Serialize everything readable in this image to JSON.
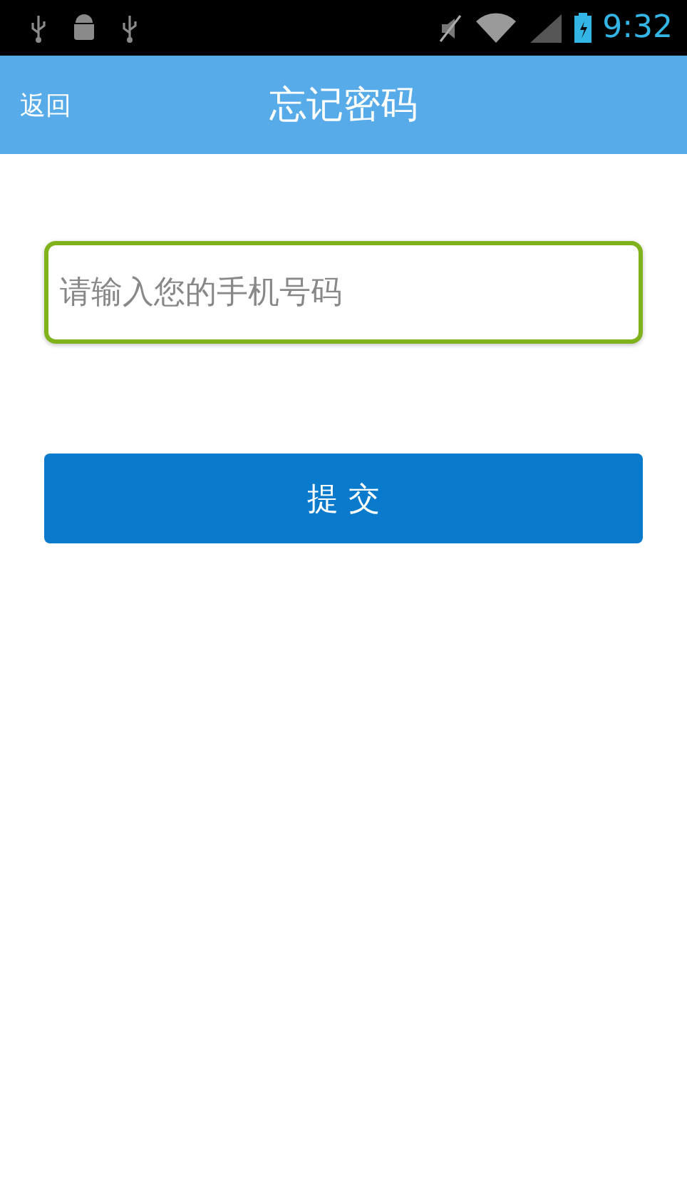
{
  "status_bar": {
    "time": "9:32"
  },
  "header": {
    "back": "返回",
    "title": "忘记密码"
  },
  "phone_field": {
    "placeholder": "请输入您的手机号码",
    "focused": true
  },
  "submit_button": "提 交"
}
